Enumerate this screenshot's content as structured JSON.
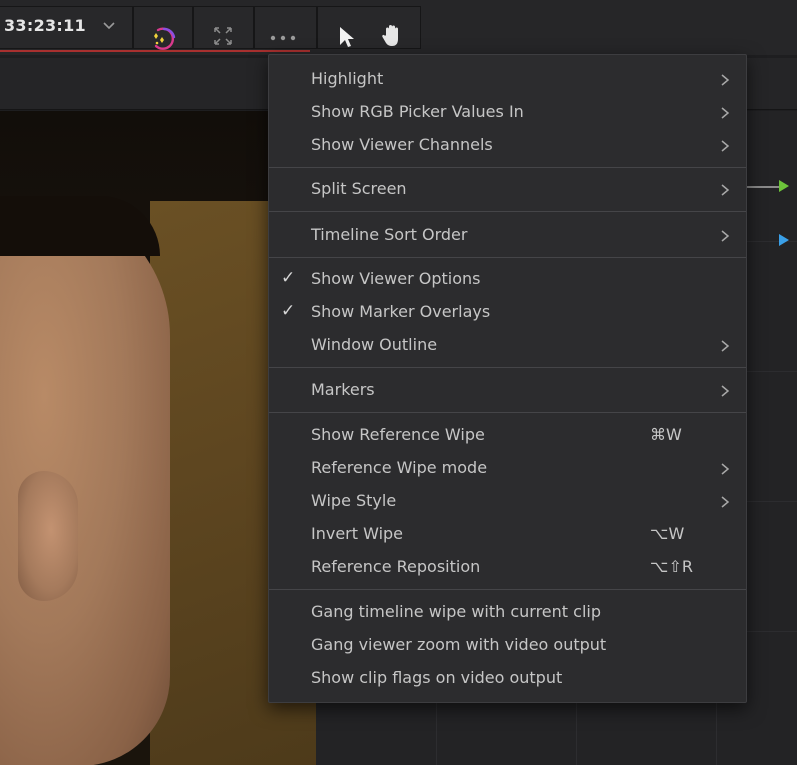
{
  "toolbar": {
    "timecode": "33:23:11",
    "icons": [
      "chevron-down-icon",
      "magic-mask-icon",
      "fullscreen-icon",
      "more-options-icon",
      "pointer-icon",
      "hand-icon"
    ]
  },
  "menu": {
    "items": [
      {
        "label": "Highlight",
        "submenu": true
      },
      {
        "label": "Show RGB Picker Values In",
        "submenu": true
      },
      {
        "label": "Show Viewer Channels",
        "submenu": true
      },
      {
        "label": "Split Screen",
        "submenu": true
      },
      {
        "label": "Timeline Sort Order",
        "submenu": true
      },
      {
        "label": "Show Viewer Options",
        "checked": true
      },
      {
        "label": "Show Marker Overlays",
        "checked": true
      },
      {
        "label": "Window Outline",
        "submenu": true
      },
      {
        "label": "Markers",
        "submenu": true
      },
      {
        "label": "Show Reference Wipe",
        "shortcut": "⌘W"
      },
      {
        "label": "Reference Wipe mode",
        "submenu": true
      },
      {
        "label": "Wipe Style",
        "submenu": true
      },
      {
        "label": "Invert Wipe",
        "shortcut": "⌥W"
      },
      {
        "label": "Reference Reposition",
        "shortcut": "⌥⇧R"
      },
      {
        "label": "Gang timeline wipe with current clip"
      },
      {
        "label": "Gang viewer zoom with video output"
      },
      {
        "label": "Show clip flags on video output"
      }
    ],
    "check_mark": "✓"
  },
  "colors": {
    "accent_red": "#a8302f",
    "node_green": "#6cc33a",
    "node_blue": "#3aa0e8",
    "menu_bg": "#2c2c2e",
    "menu_text": "#c6c6c6"
  }
}
